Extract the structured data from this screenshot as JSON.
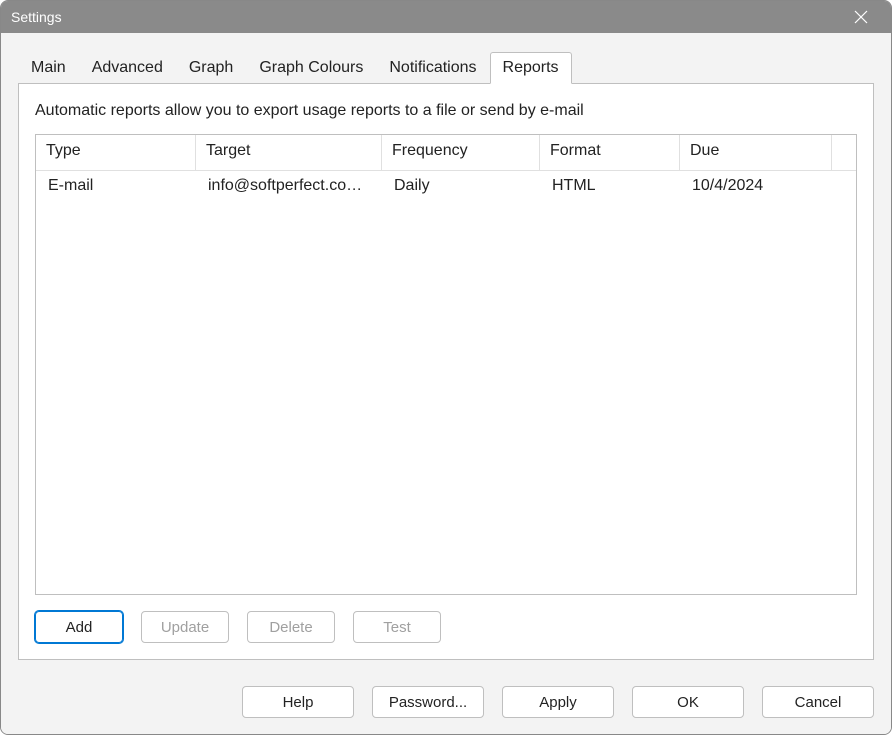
{
  "window": {
    "title": "Settings"
  },
  "tabs": {
    "main": "Main",
    "advanced": "Advanced",
    "graph": "Graph",
    "graph_colours": "Graph Colours",
    "notifications": "Notifications",
    "reports": "Reports"
  },
  "reports_panel": {
    "description": "Automatic reports allow you to export usage reports to a file or send by e-mail",
    "columns": {
      "type": "Type",
      "target": "Target",
      "frequency": "Frequency",
      "format": "Format",
      "due": "Due"
    },
    "rows": [
      {
        "type": "E-mail",
        "target": "info@softperfect.co…",
        "frequency": "Daily",
        "format": "HTML",
        "due": "10/4/2024"
      }
    ],
    "buttons": {
      "add": "Add",
      "update": "Update",
      "delete": "Delete",
      "test": "Test"
    }
  },
  "footer": {
    "help": "Help",
    "password": "Password...",
    "apply": "Apply",
    "ok": "OK",
    "cancel": "Cancel"
  }
}
